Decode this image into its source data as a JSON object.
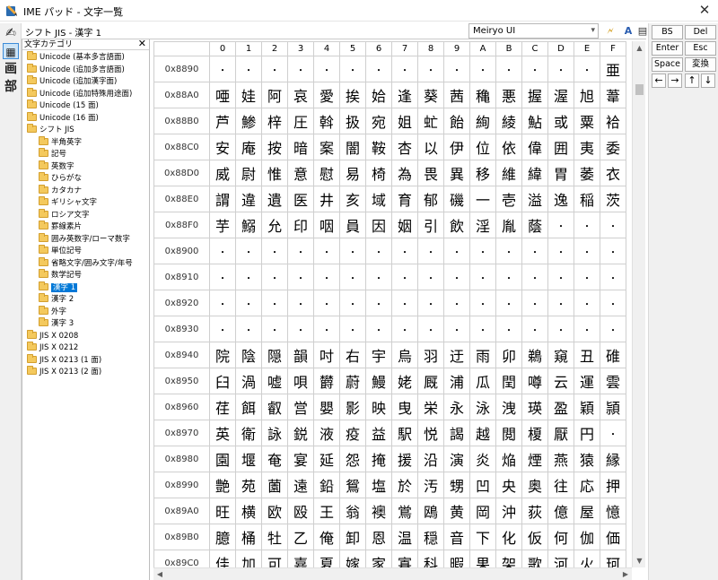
{
  "window": {
    "title": "IME パッド - 文字一覧",
    "close_glyph": "✕"
  },
  "toolstrip": {
    "items": [
      "✍",
      "▦",
      "画",
      "部"
    ]
  },
  "header": {
    "mode_label": "シフト JIS - 漢字 1",
    "font_value": "Meiryo UI",
    "icons": [
      "🗲",
      "A",
      "▤"
    ]
  },
  "category_panel": {
    "title": "文字カテゴリ",
    "close_glyph": "✕",
    "items": [
      {
        "label": "Unicode (基本多言語面)",
        "level": 0
      },
      {
        "label": "Unicode (追加多言語面)",
        "level": 0
      },
      {
        "label": "Unicode (追加漢字面)",
        "level": 0
      },
      {
        "label": "Unicode (追加特殊用途面)",
        "level": 0
      },
      {
        "label": "Unicode (15 面)",
        "level": 0
      },
      {
        "label": "Unicode (16 面)",
        "level": 0
      },
      {
        "label": "シフト JIS",
        "level": 0
      },
      {
        "label": "半角英字",
        "level": 1
      },
      {
        "label": "記号",
        "level": 1
      },
      {
        "label": "英数字",
        "level": 1
      },
      {
        "label": "ひらがな",
        "level": 1
      },
      {
        "label": "カタカナ",
        "level": 1
      },
      {
        "label": "ギリシャ文字",
        "level": 1
      },
      {
        "label": "ロシア文字",
        "level": 1
      },
      {
        "label": "罫線素片",
        "level": 1
      },
      {
        "label": "囲み英数字/ローマ数字",
        "level": 1
      },
      {
        "label": "単位記号",
        "level": 1
      },
      {
        "label": "省略文字/囲み文字/年号",
        "level": 1
      },
      {
        "label": "数学記号",
        "level": 1
      },
      {
        "label": "漢字 1",
        "level": 1,
        "selected": true
      },
      {
        "label": "漢字 2",
        "level": 1
      },
      {
        "label": "外字",
        "level": 1
      },
      {
        "label": "漢字 3",
        "level": 1
      },
      {
        "label": "JIS X 0208",
        "level": 0
      },
      {
        "label": "JIS X 0212",
        "level": 0
      },
      {
        "label": "JIS X 0213 (1 面)",
        "level": 0
      },
      {
        "label": "JIS X 0213 (2 面)",
        "level": 0
      }
    ]
  },
  "grid": {
    "columns": [
      "0",
      "1",
      "2",
      "3",
      "4",
      "5",
      "6",
      "7",
      "8",
      "9",
      "A",
      "B",
      "C",
      "D",
      "E",
      "F"
    ],
    "rows": [
      {
        "code": "0x8890",
        "chars": "・・・・・・・・・・・・・・・亜"
      },
      {
        "code": "0x88A0",
        "chars": "唖娃阿哀愛挨姶逢葵茜穐悪握渥旭葦"
      },
      {
        "code": "0x88B0",
        "chars": "芦鯵梓圧斡扱宛姐虻飴絢綾鮎或粟袷"
      },
      {
        "code": "0x88C0",
        "chars": "安庵按暗案闇鞍杏以伊位依偉囲夷委"
      },
      {
        "code": "0x88D0",
        "chars": "威尉惟意慰易椅為畏異移維緯胃萎衣"
      },
      {
        "code": "0x88E0",
        "chars": "謂違遺医井亥域育郁磯一壱溢逸稲茨"
      },
      {
        "code": "0x88F0",
        "chars": "芋鰯允印咽員因姻引飲淫胤蔭・・・"
      },
      {
        "code": "0x8900",
        "chars": "・・・・・・・・・・・・・・・・"
      },
      {
        "code": "0x8910",
        "chars": "・・・・・・・・・・・・・・・・"
      },
      {
        "code": "0x8920",
        "chars": "・・・・・・・・・・・・・・・・"
      },
      {
        "code": "0x8930",
        "chars": "・・・・・・・・・・・・・・・・"
      },
      {
        "code": "0x8940",
        "chars": "院陰隠韻吋右宇烏羽迂雨卯鵜窺丑碓"
      },
      {
        "code": "0x8950",
        "chars": "臼渦嘘唄欝蔚鰻姥厩浦瓜閏噂云運雲"
      },
      {
        "code": "0x8960",
        "chars": "荏餌叡営嬰影映曳栄永泳洩瑛盈穎頴"
      },
      {
        "code": "0x8970",
        "chars": "英衛詠鋭液疫益駅悦謁越閲榎厭円・"
      },
      {
        "code": "0x8980",
        "chars": "園堰奄宴延怨掩援沿演炎焔煙燕猿縁"
      },
      {
        "code": "0x8990",
        "chars": "艶苑薗遠鉛鴛塩於汚甥凹央奥往応押"
      },
      {
        "code": "0x89A0",
        "chars": "旺横欧殴王翁襖鴬鴎黄岡沖荻億屋憶"
      },
      {
        "code": "0x89B0",
        "chars": "臆桶牡乙俺卸恩温穏音下化仮何伽価"
      },
      {
        "code": "0x89C0",
        "chars": "佳加可嘉夏嫁家寡科暇果架歌河火珂"
      }
    ]
  },
  "keypad": {
    "keys": [
      "BS",
      "Del",
      "Enter",
      "Esc",
      "Space",
      "変換"
    ],
    "arrows": [
      "←",
      "→",
      "↑",
      "↓"
    ]
  },
  "scrollbars": {
    "up": "▲",
    "down": "▼",
    "left": "◀",
    "right": "▶"
  }
}
